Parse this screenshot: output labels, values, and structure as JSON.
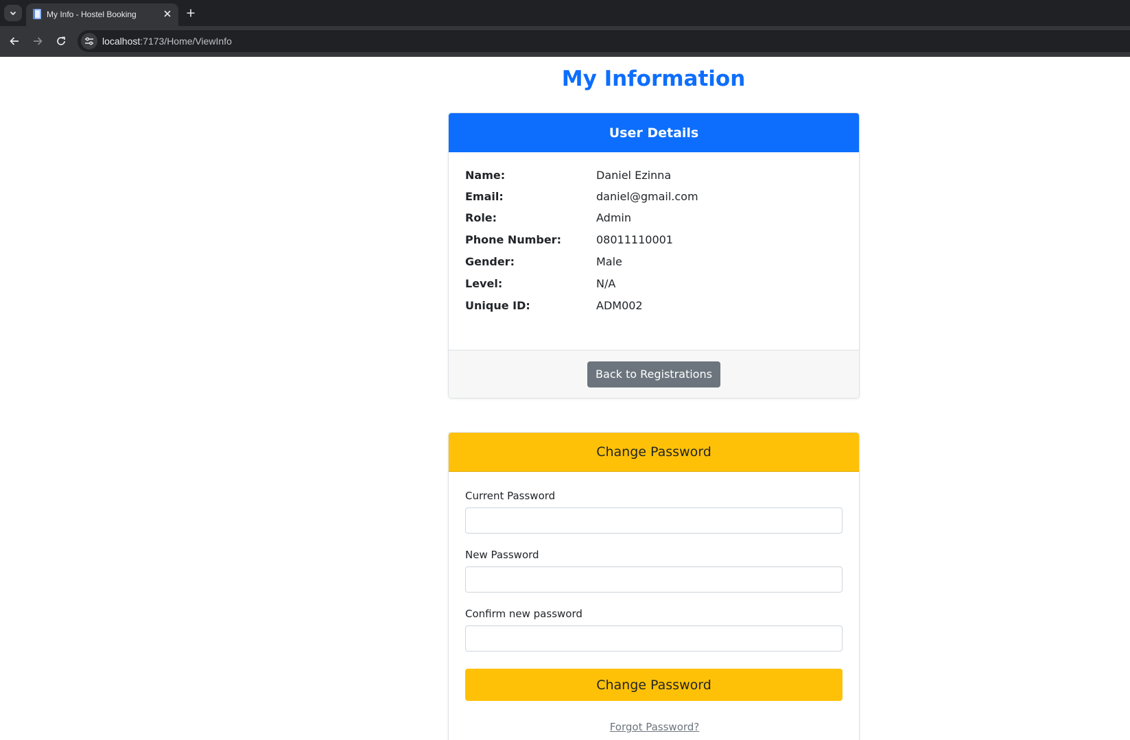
{
  "browser": {
    "tab_title": "My Info - Hostel Booking",
    "url_host": "localhost",
    "url_path": ":7173/Home/ViewInfo",
    "icons": {
      "tab_menu": "chevron-down-icon",
      "favicon": "page-icon",
      "close": "close-icon",
      "new_tab": "plus-icon",
      "back": "arrow-left-icon",
      "forward": "arrow-right-icon",
      "reload": "reload-icon",
      "site_info": "tune-icon"
    }
  },
  "page": {
    "title": "My Information"
  },
  "user_details": {
    "header": "User Details",
    "rows": [
      {
        "label": "Name:",
        "value": "Daniel Ezinna"
      },
      {
        "label": "Email:",
        "value": "daniel@gmail.com"
      },
      {
        "label": "Role:",
        "value": "Admin"
      },
      {
        "label": "Phone Number:",
        "value": "08011110001"
      },
      {
        "label": "Gender:",
        "value": "Male"
      },
      {
        "label": "Level:",
        "value": "N/A"
      },
      {
        "label": "Unique ID:",
        "value": "ADM002"
      }
    ],
    "back_button": "Back to Registrations"
  },
  "change_password": {
    "header": "Change Password",
    "current_label": "Current Password",
    "current_value": "",
    "new_label": "New Password",
    "new_value": "",
    "confirm_label": "Confirm new password",
    "confirm_value": "",
    "submit": "Change Password",
    "forgot": "Forgot Password?"
  },
  "colors": {
    "primary": "#0d6efd",
    "warning": "#ffc107",
    "secondary": "#6c757d"
  }
}
